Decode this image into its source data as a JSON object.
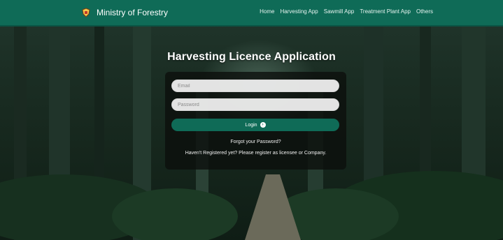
{
  "header": {
    "brand": "Ministry of Forestry",
    "crest_icon": "coat-of-arms-icon",
    "nav": [
      "Home",
      "Harvesting App",
      "Sawmill App",
      "Treatment Plant App",
      "Others"
    ]
  },
  "main": {
    "title": "Harvesting Licence Application",
    "email_placeholder": "Email",
    "password_placeholder": "Password",
    "login_label": "Login",
    "login_icon": "arrow-circle-right-icon",
    "forgot_password": "Forgot your Password?",
    "register_text": "Haven't Registered yet? Please register as licensee or Company."
  },
  "colors": {
    "header_bg": "#0f6b57",
    "button_bg": "#0f6b57",
    "panel_bg": "rgba(12,14,12,0.78)"
  }
}
